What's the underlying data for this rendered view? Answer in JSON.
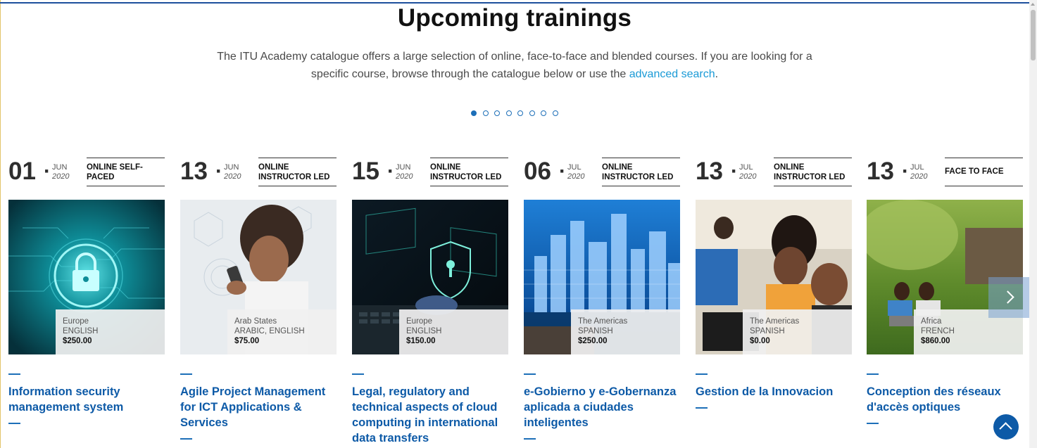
{
  "page": {
    "heading": "Upcoming trainings",
    "intro_text": "The ITU Academy catalogue offers a large selection of online, face-to-face and blended courses. If you are looking for a specific course, browse through the catalogue below or use the",
    "intro_link": "advanced search",
    "intro_end": "."
  },
  "carousel": {
    "page_count": 8,
    "active_page": 1
  },
  "courses": [
    {
      "day": "01",
      "month": "JUN",
      "year": "2020",
      "mode": "ONLINE SELF-PACED",
      "region": "Europe",
      "language": "ENGLISH",
      "price": "$250.00",
      "title": "Information security management system"
    },
    {
      "day": "13",
      "month": "JUN",
      "year": "2020",
      "mode": "ONLINE INSTRUCTOR LED",
      "region": "Arab States",
      "language": "ARABIC, ENGLISH",
      "price": "$75.00",
      "title": "Agile Project Management for ICT Applications & Services"
    },
    {
      "day": "15",
      "month": "JUN",
      "year": "2020",
      "mode": "ONLINE INSTRUCTOR LED",
      "region": "Europe",
      "language": "ENGLISH",
      "price": "$150.00",
      "title": "Legal, regulatory and technical aspects of cloud computing in international data transfers"
    },
    {
      "day": "06",
      "month": "JUL",
      "year": "2020",
      "mode": "ONLINE INSTRUCTOR LED",
      "region": "The Americas",
      "language": "SPANISH",
      "price": "$250.00",
      "title": "e-Gobierno y e-Gobernanza aplicada a ciudades inteligentes"
    },
    {
      "day": "13",
      "month": "JUL",
      "year": "2020",
      "mode": "ONLINE INSTRUCTOR LED",
      "region": "The Americas",
      "language": "SPANISH",
      "price": "$0.00",
      "title": "Gestion de la Innovacion"
    },
    {
      "day": "13",
      "month": "JUL",
      "year": "2020",
      "mode": "FACE TO FACE",
      "region": "Africa",
      "language": "FRENCH",
      "price": "$860.00",
      "title": "Conception des réseaux d'accès optiques"
    }
  ],
  "icons": {
    "next": "chevron-right-icon",
    "back_to_top": "chevron-up-icon"
  },
  "colors": {
    "accent": "#0d5aa7",
    "link": "#1a9ad6",
    "top_border": "#1d4f9c"
  }
}
